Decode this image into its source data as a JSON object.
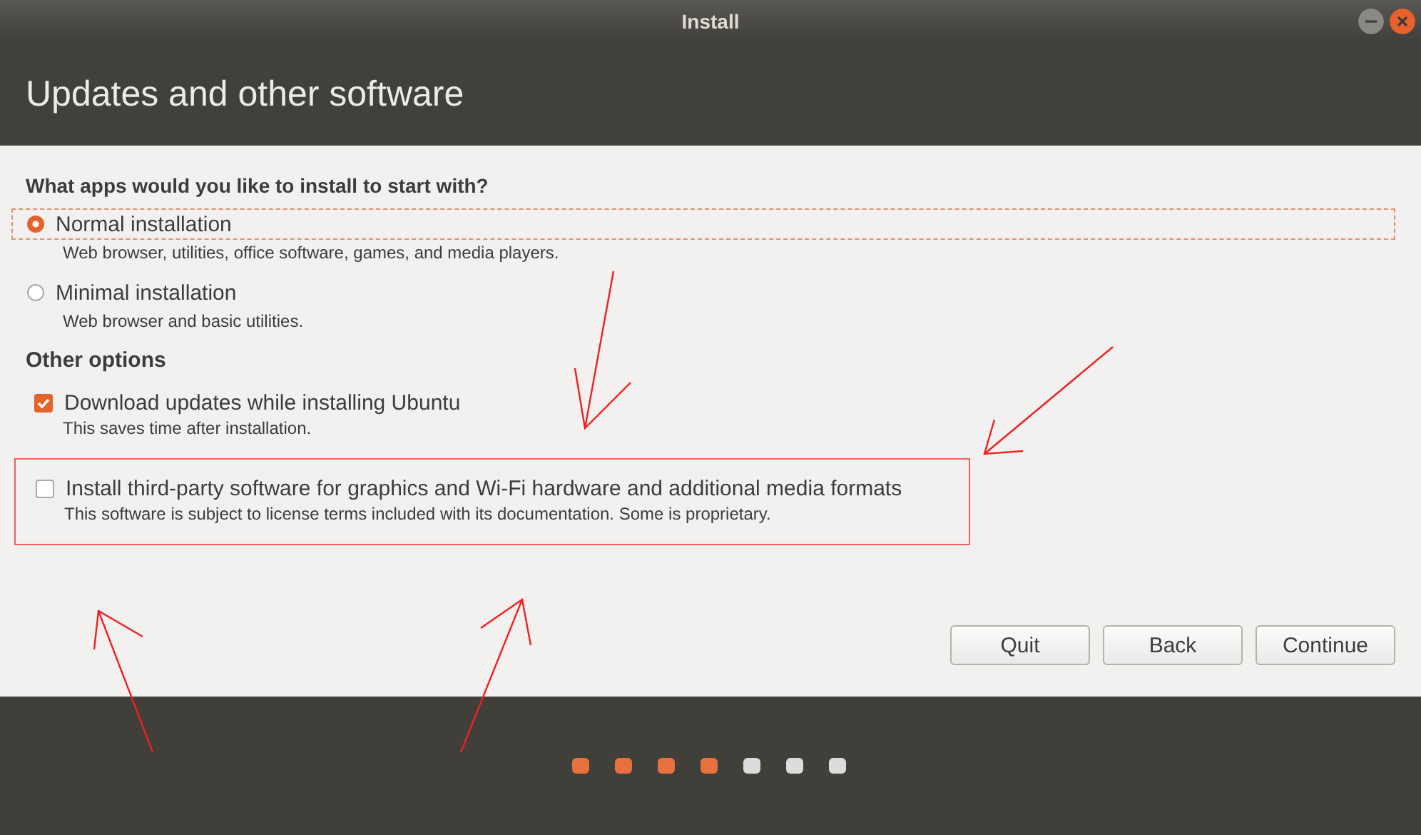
{
  "window": {
    "title": "Install"
  },
  "page_title": "Updates and other software",
  "question": "What apps would you like to install to start with?",
  "install_types": [
    {
      "label": "Normal installation",
      "description": "Web browser, utilities, office software, games, and media players.",
      "selected": true
    },
    {
      "label": "Minimal installation",
      "description": "Web browser and basic utilities.",
      "selected": false
    }
  ],
  "other_options_heading": "Other options",
  "other_options": [
    {
      "label": "Download updates while installing Ubuntu",
      "description": "This saves time after installation.",
      "checked": true,
      "highlighted": false
    },
    {
      "label": "Install third-party software for graphics and Wi-Fi hardware and additional media formats",
      "description": "This software is subject to license terms included with its documentation. Some is proprietary.",
      "checked": false,
      "highlighted": true
    }
  ],
  "buttons": [
    "Quit",
    "Back",
    "Continue"
  ],
  "progress_steps": [
    {
      "done": true
    },
    {
      "done": true
    },
    {
      "done": true
    },
    {
      "done": true
    },
    {
      "done": false
    },
    {
      "done": false
    },
    {
      "done": false
    }
  ]
}
